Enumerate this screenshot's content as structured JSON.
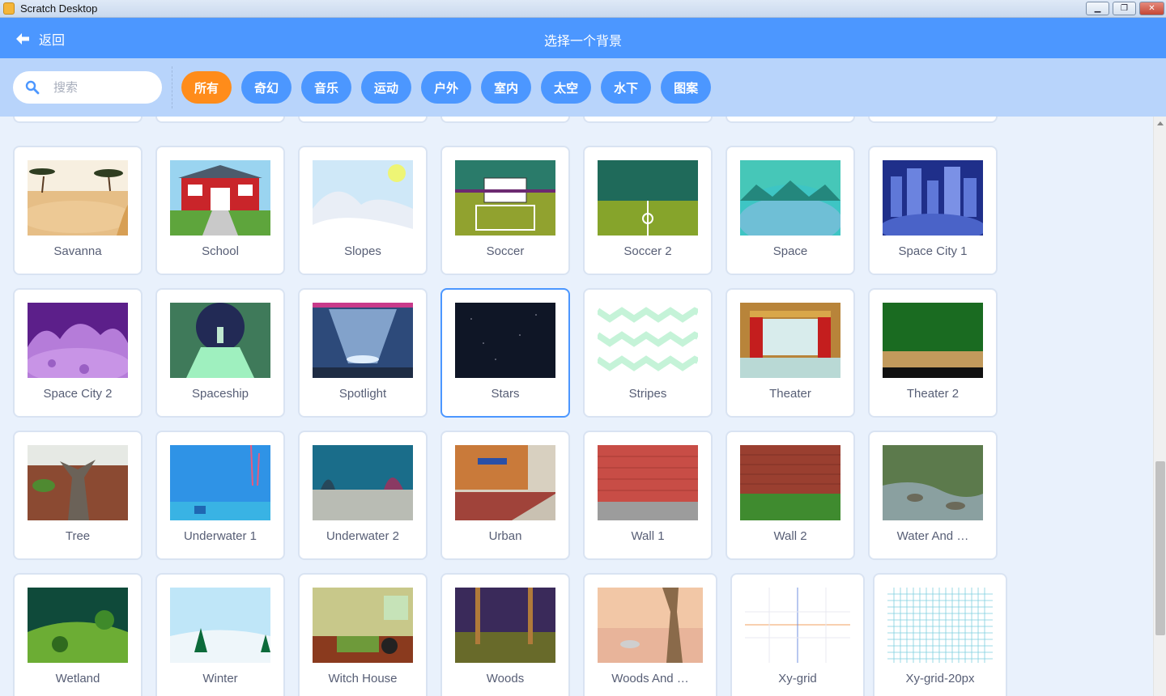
{
  "window": {
    "title": "Scratch Desktop",
    "minimize": "▁",
    "restore": "❐",
    "close": "✕"
  },
  "header": {
    "back_label": "返回",
    "title": "选择一个背景"
  },
  "search": {
    "placeholder": "搜索",
    "value": ""
  },
  "tags": [
    {
      "label": "所有",
      "active": true
    },
    {
      "label": "奇幻"
    },
    {
      "label": "音乐"
    },
    {
      "label": "运动"
    },
    {
      "label": "户外"
    },
    {
      "label": "室内"
    },
    {
      "label": "太空"
    },
    {
      "label": "水下"
    },
    {
      "label": "图案"
    }
  ],
  "backdrops": [
    {
      "label": "Savanna",
      "icon": "savanna-thumbnail"
    },
    {
      "label": "School",
      "icon": "school-thumbnail"
    },
    {
      "label": "Slopes",
      "icon": "slopes-thumbnail"
    },
    {
      "label": "Soccer",
      "icon": "soccer-thumbnail"
    },
    {
      "label": "Soccer 2",
      "icon": "soccer-2-thumbnail"
    },
    {
      "label": "Space",
      "icon": "space-thumbnail"
    },
    {
      "label": "Space City 1",
      "icon": "space-city-1-thumbnail"
    },
    {
      "label": "Space City 2",
      "icon": "space-city-2-thumbnail"
    },
    {
      "label": "Spaceship",
      "icon": "spaceship-thumbnail"
    },
    {
      "label": "Spotlight",
      "icon": "spotlight-thumbnail"
    },
    {
      "label": "Stars",
      "icon": "stars-thumbnail",
      "selected": true
    },
    {
      "label": "Stripes",
      "icon": "stripes-thumbnail"
    },
    {
      "label": "Theater",
      "icon": "theater-thumbnail"
    },
    {
      "label": "Theater 2",
      "icon": "theater-2-thumbnail"
    },
    {
      "label": "Tree",
      "icon": "tree-thumbnail"
    },
    {
      "label": "Underwater 1",
      "icon": "underwater-1-thumbnail"
    },
    {
      "label": "Underwater 2",
      "icon": "underwater-2-thumbnail"
    },
    {
      "label": "Urban",
      "icon": "urban-thumbnail"
    },
    {
      "label": "Wall 1",
      "icon": "wall-1-thumbnail"
    },
    {
      "label": "Wall 2",
      "icon": "wall-2-thumbnail"
    },
    {
      "label": "Water And …",
      "icon": "water-and-rocks-thumbnail"
    },
    {
      "label": "Wetland",
      "icon": "wetland-thumbnail"
    },
    {
      "label": "Winter",
      "icon": "winter-thumbnail"
    },
    {
      "label": "Witch House",
      "icon": "witch-house-thumbnail"
    },
    {
      "label": "Woods",
      "icon": "woods-thumbnail"
    },
    {
      "label": "Woods And …",
      "icon": "woods-and-bench-thumbnail"
    },
    {
      "label": "Xy-grid",
      "icon": "xy-grid-thumbnail"
    },
    {
      "label": "Xy-grid-20px",
      "icon": "xy-grid-20px-thumbnail"
    }
  ],
  "colors": {
    "header": "#4c97ff",
    "filterbar": "#b8d4fb",
    "active_tag": "#ff8c1a",
    "tag": "#4c97ff",
    "label_text": "#575e75"
  }
}
